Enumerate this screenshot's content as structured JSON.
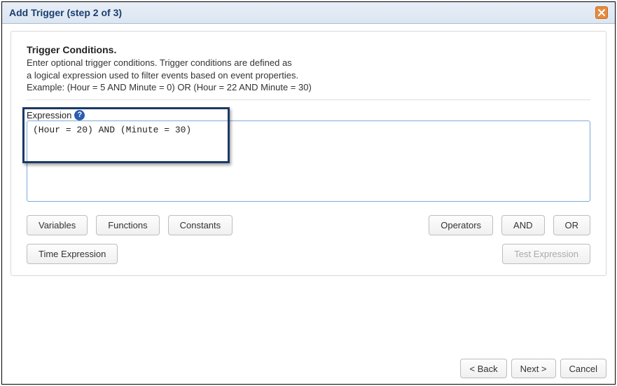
{
  "window": {
    "title": "Add Trigger (step 2 of 3)"
  },
  "section": {
    "heading": "Trigger Conditions.",
    "line1": "Enter optional trigger conditions. Trigger conditions are defined as",
    "line2": "a logical expression used to filter events based on event properties.",
    "line3": "Example: (Hour = 5 AND Minute = 0) OR (Hour = 22 AND Minute = 30)"
  },
  "expression": {
    "label": "Expression",
    "value": "(Hour = 20) AND (Minute = 30)"
  },
  "buttons": {
    "variables": "Variables",
    "functions": "Functions",
    "constants": "Constants",
    "operators": "Operators",
    "and": "AND",
    "or": "OR",
    "time_expression": "Time Expression",
    "test_expression": "Test Expression"
  },
  "footer": {
    "back": "< Back",
    "next": "Next >",
    "cancel": "Cancel"
  }
}
